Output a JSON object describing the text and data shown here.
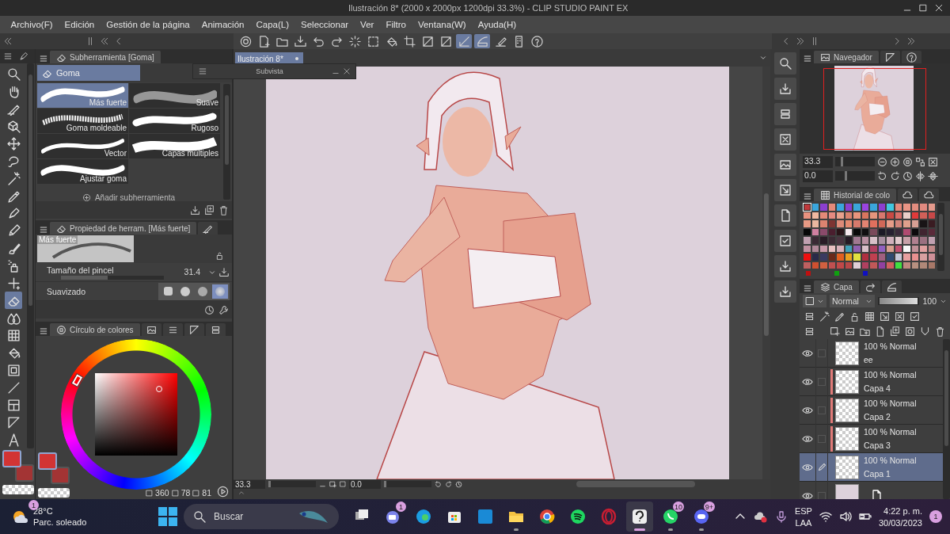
{
  "window": {
    "title": "Ilustración 8* (2000 x 2000px 1200dpi 33.3%)  - CLIP STUDIO PAINT EX"
  },
  "menu": [
    "Archivo(F)",
    "Edición",
    "Gestión de la página",
    "Animación",
    "Capa(L)",
    "Seleccionar",
    "Ver",
    "Filtro",
    "Ventana(W)",
    "Ayuda(H)"
  ],
  "command_bar": [
    {
      "kind": "spiral",
      "selected": false
    },
    {
      "kind": "new-file",
      "selected": false
    },
    {
      "kind": "folder",
      "selected": false
    },
    {
      "kind": "download",
      "selected": false
    },
    {
      "kind": "undo",
      "selected": false
    },
    {
      "kind": "redo",
      "selected": false
    },
    {
      "kind": "dotted-circle",
      "selected": false
    },
    {
      "kind": "dashed-square",
      "selected": false
    },
    {
      "kind": "bucket",
      "selected": false
    },
    {
      "kind": "crop",
      "selected": false
    },
    {
      "kind": "diagonal",
      "selected": false
    },
    {
      "kind": "diagonal",
      "selected": false
    },
    {
      "kind": "ruler",
      "selected": true
    },
    {
      "kind": "curve",
      "selected": true
    },
    {
      "kind": "pencil-line",
      "selected": false
    },
    {
      "kind": "device",
      "selected": false
    },
    {
      "kind": "help",
      "selected": false
    }
  ],
  "tools": [
    {
      "kind": "magnifier",
      "selected": false
    },
    {
      "kind": "hand",
      "selected": false
    },
    {
      "kind": "pen-nib",
      "selected": false
    },
    {
      "kind": "cube",
      "selected": false
    },
    {
      "kind": "move",
      "selected": false
    },
    {
      "kind": "lasso",
      "selected": false
    },
    {
      "kind": "wand",
      "selected": false
    },
    {
      "kind": "dropper",
      "selected": false
    },
    {
      "kind": "pen",
      "selected": false
    },
    {
      "kind": "pencil",
      "selected": false
    },
    {
      "kind": "brush",
      "selected": false
    },
    {
      "kind": "airbrush",
      "selected": false
    },
    {
      "kind": "sparkle",
      "selected": false
    },
    {
      "kind": "eraser",
      "selected": true
    },
    {
      "kind": "drops",
      "selected": false
    },
    {
      "kind": "grid",
      "selected": false
    },
    {
      "kind": "bucket",
      "selected": false
    },
    {
      "kind": "gradient",
      "selected": false
    },
    {
      "kind": "line",
      "selected": false
    },
    {
      "kind": "frame",
      "selected": false
    },
    {
      "kind": "triangle",
      "selected": false
    },
    {
      "kind": "letter",
      "selected": false
    }
  ],
  "toolbox_colors": {
    "main": {
      "color": "#d23434"
    },
    "sub": {
      "color": "#a33434"
    }
  },
  "subtool_panel": {
    "tab": "Subherramienta [Goma]",
    "group": "Goma",
    "subtools": [
      {
        "name": "Más fuerte",
        "selected": true
      },
      {
        "name": "Suave",
        "selected": false
      },
      {
        "name": "Goma moldeable",
        "selected": false
      },
      {
        "name": "Rugoso",
        "selected": false
      },
      {
        "name": "Vector",
        "selected": false
      },
      {
        "name": "Capas múltiples",
        "selected": false
      },
      {
        "name": "Ajustar goma",
        "selected": false
      }
    ],
    "add_button": "Añadir subherramienta"
  },
  "tool_property": {
    "tab": "Propiedad de herram. [Más fuerte]",
    "preview": "Más fuerte",
    "brush_size": {
      "label": "Tamaño del pincel",
      "value": "31.4",
      "level": 0.45
    },
    "smoothing": {
      "label": "Suavizado",
      "options": [
        {
          "selected": false
        },
        {
          "selected": false
        },
        {
          "selected": false
        },
        {
          "selected": true
        }
      ]
    }
  },
  "color_panel": {
    "tab": "Círculo de colores",
    "main": {
      "color": "#d23434"
    },
    "sub": {
      "color": "#a33434"
    },
    "hue": "360",
    "saturation": "78",
    "value": "81"
  },
  "canvas": {
    "tab": "Ilustración 8*",
    "subview": "Subvista",
    "zoom": {
      "value": "33.3",
      "level": 0
    },
    "angle": {
      "value": "0.0",
      "level": 0
    }
  },
  "navigator": {
    "tab": "Navegador",
    "zoom": {
      "value": "33.3",
      "level": 0.2
    },
    "rotation": {
      "value": "0.0",
      "level": 0.3
    }
  },
  "color_history": {
    "tab": "Historial de colo",
    "swatches": [
      [
        {
          "color": "#c0393b",
          "selected": true
        },
        {
          "color": "#3aa6dc",
          "selected": false
        },
        {
          "color": "#8c3fd0",
          "selected": false
        },
        {
          "color": "#e68a7a",
          "selected": false
        },
        {
          "color": "#3aa6dc",
          "selected": false
        },
        {
          "color": "#8c3fd0",
          "selected": false
        },
        {
          "color": "#3aa6dc",
          "selected": false
        },
        {
          "color": "#9a44e0",
          "selected": false
        },
        {
          "color": "#3aa6dc",
          "selected": false
        },
        {
          "color": "#8c3fd0",
          "selected": false
        },
        {
          "color": "#40c8e0",
          "selected": false
        },
        {
          "color": "#e48a7c",
          "selected": false
        },
        {
          "color": "#e99585",
          "selected": false
        },
        {
          "color": "#e28c7e",
          "selected": false
        },
        {
          "color": "#e18a80",
          "selected": false
        },
        {
          "color": "#e59a8c",
          "selected": false
        }
      ],
      [
        {
          "color": "#e9927f",
          "selected": false
        },
        {
          "color": "#efb8a0",
          "selected": false
        },
        {
          "color": "#e48a78",
          "selected": false
        },
        {
          "color": "#e58a80",
          "selected": false
        },
        {
          "color": "#e7a08c",
          "selected": false
        },
        {
          "color": "#d9826e",
          "selected": false
        },
        {
          "color": "#e9957d",
          "selected": false
        },
        {
          "color": "#d9755e",
          "selected": false
        },
        {
          "color": "#e6957d",
          "selected": false
        },
        {
          "color": "#d9786e",
          "selected": false
        },
        {
          "color": "#c84a44",
          "selected": false
        },
        {
          "color": "#d86f68",
          "selected": false
        },
        {
          "color": "#ead0c8",
          "selected": false
        },
        {
          "color": "#e03a3a",
          "selected": false
        },
        {
          "color": "#d26058",
          "selected": false
        },
        {
          "color": "#c84848",
          "selected": false
        }
      ],
      [
        {
          "color": "#e79a84",
          "selected": false
        },
        {
          "color": "#e9b7a0",
          "selected": false
        },
        {
          "color": "#dc8470",
          "selected": false
        },
        {
          "color": "#7c3432",
          "selected": false
        },
        {
          "color": "#dd8a78",
          "selected": false
        },
        {
          "color": "#e58a70",
          "selected": false
        },
        {
          "color": "#d77a6c",
          "selected": false
        },
        {
          "color": "#e28472",
          "selected": false
        },
        {
          "color": "#e0705e",
          "selected": false
        },
        {
          "color": "#d06858",
          "selected": false
        },
        {
          "color": "#e69c88",
          "selected": false
        },
        {
          "color": "#d2847a",
          "selected": false
        },
        {
          "color": "#e0a08c",
          "selected": false
        },
        {
          "color": "#d8a094",
          "selected": false
        },
        {
          "color": "#191416",
          "selected": false
        },
        {
          "color": "#3a1c22",
          "selected": false
        }
      ],
      [
        {
          "color": "#070707",
          "selected": false
        },
        {
          "color": "#d080a0",
          "selected": false
        },
        {
          "color": "#8a4a6a",
          "selected": false
        },
        {
          "color": "#4a1e2e",
          "selected": false
        },
        {
          "color": "#2a1418",
          "selected": false
        },
        {
          "color": "#f6e8ec",
          "selected": false
        },
        {
          "color": "#0a0a0a",
          "selected": false
        },
        {
          "color": "#101010",
          "selected": false
        },
        {
          "color": "#7a4a5a",
          "selected": false
        },
        {
          "color": "#1c1a26",
          "selected": false
        },
        {
          "color": "#262030",
          "selected": false
        },
        {
          "color": "#3a2a3a",
          "selected": false
        },
        {
          "color": "#b04a70",
          "selected": false
        },
        {
          "color": "#0c0a0c",
          "selected": false
        },
        {
          "color": "#402430",
          "selected": false
        },
        {
          "color": "#5a2a3a",
          "selected": false
        }
      ],
      [
        {
          "color": "#c0a0b0",
          "selected": false
        },
        {
          "color": "#3a2a34",
          "selected": false
        },
        {
          "color": "#2a1c26",
          "selected": false
        },
        {
          "color": "#3c2a34",
          "selected": false
        },
        {
          "color": "#4a3440",
          "selected": false
        },
        {
          "color": "#261a24",
          "selected": false
        },
        {
          "color": "#a07890",
          "selected": false
        },
        {
          "color": "#b890a0",
          "selected": false
        },
        {
          "color": "#d8c0c8",
          "selected": false
        },
        {
          "color": "#a890a0",
          "selected": false
        },
        {
          "color": "#d0b0bc",
          "selected": false
        },
        {
          "color": "#e0c8cc",
          "selected": false
        },
        {
          "color": "#c8a0a8",
          "selected": false
        },
        {
          "color": "#b08090",
          "selected": false
        },
        {
          "color": "#9a7080",
          "selected": false
        },
        {
          "color": "#c0a0b0",
          "selected": false
        }
      ],
      [
        {
          "color": "#c090a0",
          "selected": false
        },
        {
          "color": "#b08898",
          "selected": false
        },
        {
          "color": "#c898a8",
          "selected": false
        },
        {
          "color": "#e8c0c0",
          "selected": false
        },
        {
          "color": "#d8b0b8",
          "selected": false
        },
        {
          "color": "#40a0b8",
          "selected": false
        },
        {
          "color": "#9060b0",
          "selected": false
        },
        {
          "color": "#d8c0c8",
          "selected": false
        },
        {
          "color": "#b04060",
          "selected": false
        },
        {
          "color": "#9060c0",
          "selected": false
        },
        {
          "color": "#d8a090",
          "selected": false
        },
        {
          "color": "#c05070",
          "selected": false
        },
        {
          "color": "#f8f8f8",
          "selected": false
        },
        {
          "color": "#c09098",
          "selected": false
        },
        {
          "color": "#e0a0a0",
          "selected": false
        },
        {
          "color": "#c08888",
          "selected": false
        }
      ],
      [
        {
          "color": "#ee1010",
          "selected": false
        },
        {
          "color": "#2a2a48",
          "selected": false
        },
        {
          "color": "#3a3a60",
          "selected": false
        },
        {
          "color": "#6a2a1a",
          "selected": false
        },
        {
          "color": "#e06020",
          "selected": false
        },
        {
          "color": "#e8a020",
          "selected": false
        },
        {
          "color": "#e0e040",
          "selected": false
        },
        {
          "color": "#b03040",
          "selected": false
        },
        {
          "color": "#c04050",
          "selected": false
        },
        {
          "color": "#a06080",
          "selected": false
        },
        {
          "color": "#304a70",
          "selected": false
        },
        {
          "color": "#c8c8d8",
          "selected": false
        },
        {
          "color": "#e8a0a0",
          "selected": false
        },
        {
          "color": "#e89090",
          "selected": false
        },
        {
          "color": "#d8a0a0",
          "selected": false
        },
        {
          "color": "#d09098",
          "selected": false
        }
      ],
      [
        {
          "color": "#c06060",
          "selected": false
        },
        {
          "color": "#d05030",
          "selected": false
        },
        {
          "color": "#d06040",
          "selected": false
        },
        {
          "color": "#c05050",
          "selected": false
        },
        {
          "color": "#c04848",
          "selected": false
        },
        {
          "color": "#b84848",
          "selected": false
        },
        {
          "color": "#e0d0d8",
          "selected": false
        },
        {
          "color": "#b04060",
          "selected": false
        },
        {
          "color": "#c05858",
          "selected": false
        },
        {
          "color": "#9040a0",
          "selected": false
        },
        {
          "color": "#d06060",
          "selected": false
        },
        {
          "color": "#40e040",
          "selected": false
        },
        {
          "color": "#c08880",
          "selected": false
        },
        {
          "color": "#b89080",
          "selected": false
        },
        {
          "color": "#b08878",
          "selected": false
        },
        {
          "color": "#a87868",
          "selected": false
        }
      ]
    ],
    "channel_dots": [
      {
        "color": "#c01010"
      },
      {
        "color": "#10a010"
      },
      {
        "color": "#1010c0"
      }
    ]
  },
  "layer_panel": {
    "tab": "Capa",
    "blend_mode": "Normal",
    "opacity": {
      "value": "100",
      "level": 1
    },
    "layers": [
      {
        "kind": "raster",
        "blend": "100 % Normal",
        "name": "ee",
        "visible": true,
        "editing": false,
        "selected": false
      },
      {
        "kind": "raster",
        "blend": "100 % Normal",
        "name": "Capa 4",
        "visible": true,
        "editing": false,
        "selected": false,
        "color": "#e07a78"
      },
      {
        "kind": "raster",
        "blend": "100 % Normal",
        "name": "Capa 2",
        "visible": true,
        "editing": false,
        "selected": false,
        "color": "#e07a78"
      },
      {
        "kind": "raster",
        "blend": "100 % Normal",
        "name": "Capa 3",
        "visible": true,
        "editing": false,
        "selected": false,
        "color": "#e07a78"
      },
      {
        "kind": "raster",
        "blend": "100 % Normal",
        "name": "Capa 1",
        "visible": true,
        "editing": true,
        "selected": true
      },
      {
        "kind": "paper",
        "visible": true,
        "editing": false,
        "selected": false
      }
    ]
  },
  "taskbar": {
    "weather": {
      "temperature": "28°C",
      "condition": "Parc. soleado",
      "badge": "1"
    },
    "search": {
      "placeholder": "Buscar"
    },
    "apps": [
      {
        "kind": "task-view",
        "running": false,
        "selected": false
      },
      {
        "kind": "chat",
        "badge": "1",
        "running": false,
        "selected": false
      },
      {
        "kind": "browser-swirl",
        "running": false,
        "selected": false
      },
      {
        "kind": "store",
        "running": false,
        "selected": false
      },
      {
        "kind": "tile",
        "running": false,
        "selected": false
      },
      {
        "kind": "folder",
        "running": true,
        "selected": false
      },
      {
        "kind": "browser-ball",
        "running": false,
        "selected": false
      },
      {
        "kind": "music",
        "running": false,
        "selected": false
      },
      {
        "kind": "ring",
        "running": false,
        "selected": false
      },
      {
        "kind": "paint-app",
        "running": true,
        "selected": true
      },
      {
        "kind": "phone-bubble",
        "badge": "10",
        "running": true,
        "selected": false
      },
      {
        "kind": "gamepad-bubble",
        "badge": "9+",
        "running": true,
        "selected": false
      }
    ],
    "language": "ESP",
    "layout": "LAA",
    "time": "4:22 p. m.",
    "date": "30/03/2023",
    "notifications": "1"
  }
}
